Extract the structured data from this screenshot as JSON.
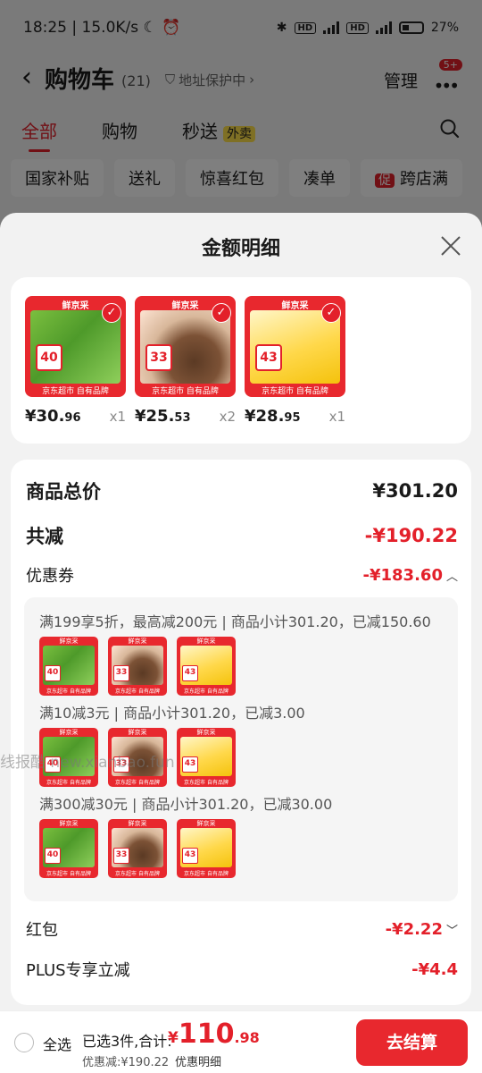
{
  "status_bar": {
    "time": "18:25",
    "speed": "15.0K/s",
    "battery": "27%"
  },
  "cart_header": {
    "title": "购物车",
    "count": "(21)",
    "address_protect": "地址保护中",
    "manage": "管理",
    "badge": "5+"
  },
  "cart_tabs": [
    {
      "label": "全部"
    },
    {
      "label": "购物"
    },
    {
      "label": "秒送",
      "tag": "外卖"
    }
  ],
  "chips": [
    {
      "label": "国家补贴"
    },
    {
      "label": "送礼"
    },
    {
      "label": "惊喜红包"
    },
    {
      "label": "凑单"
    },
    {
      "tag": "促",
      "label": "跨店满"
    }
  ],
  "sheet": {
    "title": "金额明细"
  },
  "products": [
    {
      "brand": "鲜京采",
      "badge": "40",
      "footer": "京东超市 自有品牌",
      "price_int": "¥30.",
      "price_dec": "96",
      "qty": "x1",
      "image": "green-matcha-crepe-cake"
    },
    {
      "brand": "鲜京采",
      "badge": "33",
      "footer": "京东超市 自有品牌",
      "price_int": "¥25.",
      "price_dec": "53",
      "qty": "x2",
      "image": "chocolate-cake"
    },
    {
      "brand": "鲜京采",
      "badge": "43",
      "footer": "京东超市 自有品牌",
      "price_int": "¥28.",
      "price_dec": "95",
      "qty": "x1",
      "image": "durian-cake"
    }
  ],
  "summary": {
    "goods_total_label": "商品总价",
    "goods_total_value": "¥301.20",
    "total_reduce_label": "共减",
    "total_reduce_value": "-¥190.22",
    "coupon_label": "优惠券",
    "coupon_value": "-¥183.60",
    "coupon_rules": [
      {
        "text": "满199享5折，最高减200元 | 商品小计301.20，已减150.60"
      },
      {
        "text": "满10减3元 | 商品小计301.20，已减3.00"
      },
      {
        "text": "满300减30元 | 商品小计301.20，已减30.00"
      }
    ],
    "redpacket_label": "红包",
    "redpacket_value": "-¥2.22",
    "plus_label": "PLUS专享立减",
    "plus_value": "-¥4.4"
  },
  "bottom_bar": {
    "select_all": "全选",
    "selected_summary": "已选3件,合计:",
    "total_currency": "¥",
    "total_int": "110",
    "total_dec": ".98",
    "discount_line": "优惠减:¥190.22",
    "discount_detail": "优惠明细",
    "checkout": "去结算"
  },
  "watermark": "线报酷 new.xianbao.fun",
  "colors": {
    "accent": "#e3202a",
    "sheet_bg": "#f2f2f2",
    "card_bg": "#ffffff"
  }
}
